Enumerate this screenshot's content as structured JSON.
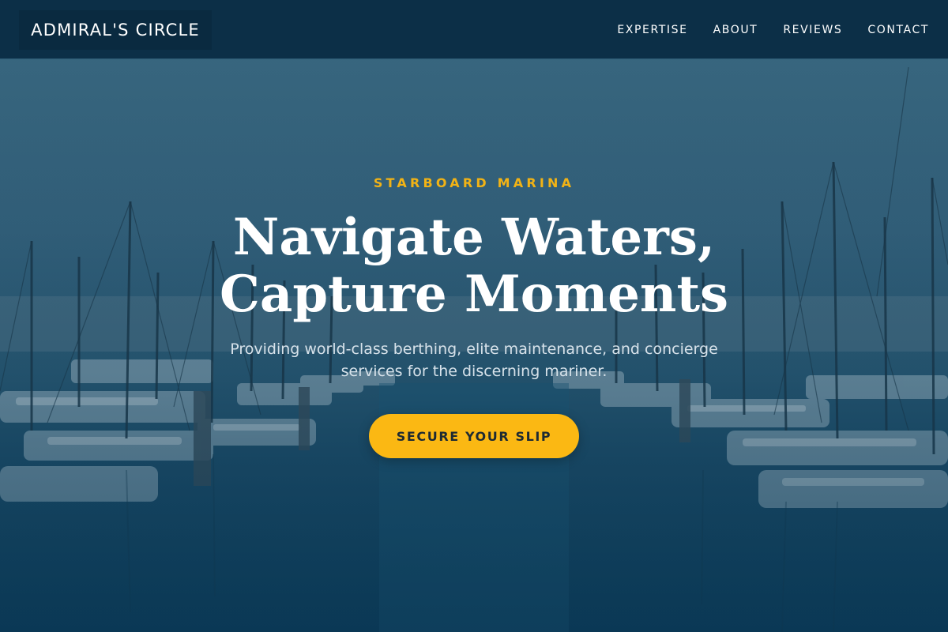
{
  "header": {
    "logo": "ADMIRAL'S CIRCLE",
    "nav": [
      {
        "label": "EXPERTISE"
      },
      {
        "label": "ABOUT"
      },
      {
        "label": "REVIEWS"
      },
      {
        "label": "CONTACT"
      }
    ]
  },
  "hero": {
    "eyebrow": "STARBOARD MARINA",
    "headline_line1": "Navigate Waters,",
    "headline_line2": "Capture Moments",
    "subtext": "Providing world-class berthing, elite maintenance, and concierge services for the discerning mariner.",
    "cta_label": "SECURE YOUR SLIP"
  },
  "colors": {
    "header_bg": "#0c2f47",
    "accent_gold": "#f2b315",
    "cta_bg": "#fbb813",
    "hero_tint": "#0b3a55"
  }
}
